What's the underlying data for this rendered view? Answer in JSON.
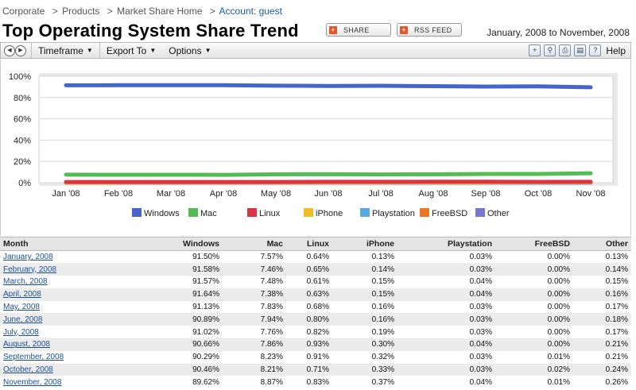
{
  "breadcrumb": [
    "Corporate",
    "Products",
    "Market Share Home"
  ],
  "breadcrumb_sep": ">",
  "account": "Account: guest",
  "page_title": "Top Operating System Share Trend",
  "share_label": "SHARE",
  "rss_label": "RSS FEED",
  "date_range": "January, 2008 to November, 2008",
  "toolbar": {
    "timeframe": "Timeframe",
    "export": "Export To",
    "options": "Options",
    "help": "Help",
    "icons": [
      "add-chart-icon",
      "find-icon",
      "print-icon",
      "document-icon"
    ]
  },
  "chart_data": {
    "type": "line",
    "x": [
      "Jan '08",
      "Feb '08",
      "Mar '08",
      "Apr '08",
      "May '08",
      "Jun '08",
      "Jul '08",
      "Aug '08",
      "Sep '08",
      "Oct '08",
      "Nov '08"
    ],
    "ylim": [
      0,
      100
    ],
    "yticks": [
      "0%",
      "20%",
      "40%",
      "60%",
      "80%",
      "100%"
    ],
    "grid": true,
    "legend_position": "bottom",
    "series": [
      {
        "name": "Windows",
        "color": "#4466cc",
        "values": [
          91.5,
          91.58,
          91.57,
          91.64,
          91.13,
          90.89,
          91.02,
          90.66,
          90.29,
          90.46,
          89.62
        ]
      },
      {
        "name": "Mac",
        "color": "#55bb55",
        "values": [
          7.57,
          7.46,
          7.48,
          7.38,
          7.83,
          7.94,
          7.76,
          7.86,
          8.23,
          8.21,
          8.87
        ]
      },
      {
        "name": "Linux",
        "color": "#dd3344",
        "values": [
          0.64,
          0.65,
          0.61,
          0.63,
          0.68,
          0.8,
          0.82,
          0.93,
          0.91,
          0.71,
          0.83
        ]
      },
      {
        "name": "iPhone",
        "color": "#f2bb22",
        "values": [
          0.13,
          0.14,
          0.15,
          0.15,
          0.16,
          0.16,
          0.19,
          0.3,
          0.32,
          0.33,
          0.37
        ]
      },
      {
        "name": "Playstation",
        "color": "#55aadd",
        "values": [
          0.03,
          0.03,
          0.04,
          0.04,
          0.03,
          0.03,
          0.03,
          0.04,
          0.03,
          0.03,
          0.04
        ]
      },
      {
        "name": "FreeBSD",
        "color": "#ee7722",
        "values": [
          0.0,
          0.0,
          0.0,
          0.0,
          0.0,
          0.0,
          0.0,
          0.0,
          0.01,
          0.02,
          0.01
        ]
      },
      {
        "name": "Other",
        "color": "#7777cc",
        "values": [
          0.13,
          0.14,
          0.15,
          0.16,
          0.17,
          0.18,
          0.17,
          0.21,
          0.21,
          0.24,
          0.26
        ]
      }
    ]
  },
  "table": {
    "headers": [
      "Month",
      "Windows",
      "Mac",
      "Linux",
      "iPhone",
      "Playstation",
      "FreeBSD",
      "Other"
    ],
    "rows": [
      [
        "January, 2008",
        "91.50%",
        "7.57%",
        "0.64%",
        "0.13%",
        "0.03%",
        "0.00%",
        "0.13%"
      ],
      [
        "February, 2008",
        "91.58%",
        "7.46%",
        "0.65%",
        "0.14%",
        "0.03%",
        "0.00%",
        "0.14%"
      ],
      [
        "March, 2008",
        "91.57%",
        "7.48%",
        "0.61%",
        "0.15%",
        "0.04%",
        "0.00%",
        "0.15%"
      ],
      [
        "April, 2008",
        "91.64%",
        "7.38%",
        "0.63%",
        "0.15%",
        "0.04%",
        "0.00%",
        "0.16%"
      ],
      [
        "May, 2008",
        "91.13%",
        "7.83%",
        "0.68%",
        "0.16%",
        "0.03%",
        "0.00%",
        "0.17%"
      ],
      [
        "June, 2008",
        "90.89%",
        "7.94%",
        "0.80%",
        "0.16%",
        "0.03%",
        "0.00%",
        "0.18%"
      ],
      [
        "July, 2008",
        "91.02%",
        "7.76%",
        "0.82%",
        "0.19%",
        "0.03%",
        "0.00%",
        "0.17%"
      ],
      [
        "August, 2008",
        "90.66%",
        "7.86%",
        "0.93%",
        "0.30%",
        "0.04%",
        "0.00%",
        "0.21%"
      ],
      [
        "September, 2008",
        "90.29%",
        "8.23%",
        "0.91%",
        "0.32%",
        "0.03%",
        "0.01%",
        "0.21%"
      ],
      [
        "October, 2008",
        "90.46%",
        "8.21%",
        "0.71%",
        "0.33%",
        "0.03%",
        "0.02%",
        "0.24%"
      ],
      [
        "November, 2008",
        "89.62%",
        "8.87%",
        "0.83%",
        "0.37%",
        "0.04%",
        "0.01%",
        "0.26%"
      ]
    ]
  }
}
